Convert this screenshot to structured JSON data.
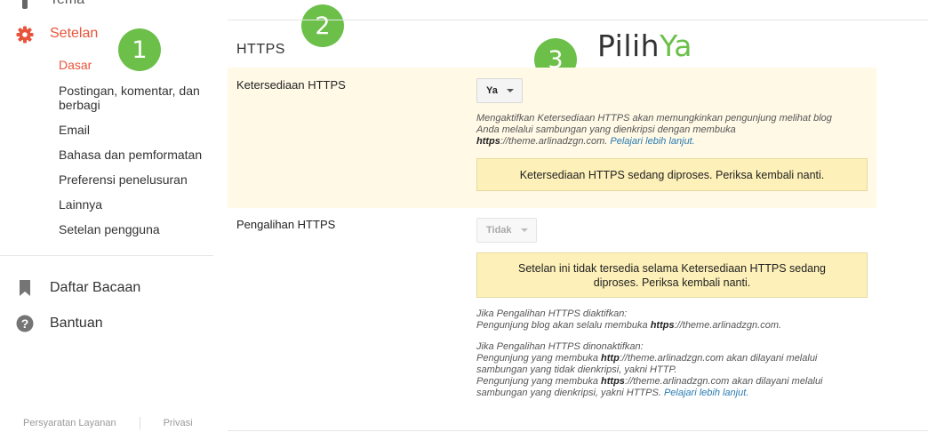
{
  "sidebar": {
    "tema_label": "Tema",
    "setelan_label": "Setelan",
    "sub_items": [
      "Dasar",
      "Postingan, komentar, dan",
      "berbagi",
      "Email",
      "Bahasa dan pemformatan",
      "Preferensi penelusuran",
      "Lainnya",
      "Setelan pengguna"
    ],
    "daftar_label": "Daftar Bacaan",
    "bantuan_label": "Bantuan",
    "footer": {
      "terms": "Persyaratan Layanan",
      "privacy": "Privasi"
    },
    "icons": {
      "tema": "palette-icon",
      "setelan": "gear-icon",
      "daftar": "bookmark-icon",
      "bantuan": "help-icon"
    }
  },
  "badges": {
    "one": "1",
    "two": "2",
    "three": "3"
  },
  "main": {
    "section_title": "HTTPS",
    "pilih": {
      "text": "Pilih",
      "ya": "Ya"
    },
    "availability": {
      "label": "Ketersediaan HTTPS",
      "select_value": "Ya",
      "desc_line1": "Mengaktifkan Ketersediaan HTTPS akan memungkinkan pengunjung melihat blog",
      "desc_line2": "Anda melalui sambungan yang dienkripsi dengan membuka",
      "desc_bold": "https",
      "desc_url": "://theme.arlinadzgn.com.",
      "desc_link": "Pelajari lebih lanjut.",
      "notice": "Ketersediaan HTTPS sedang diproses. Periksa kembali nanti."
    },
    "redirect": {
      "label": "Pengalihan HTTPS",
      "select_value": "Tidak",
      "notice_line1": "Setelan ini tidak tersedia selama Ketersediaan HTTPS sedang",
      "notice_line2": "diproses. Periksa kembali nanti.",
      "on_title": "Jika Pengalihan HTTPS diaktifkan:",
      "on_text_pre": "Pengunjung blog akan selalu membuka ",
      "on_bold": "https",
      "on_text_post": "://theme.arlinadzgn.com.",
      "off_title": "Jika Pengalihan HTTPS dinonaktifkan:",
      "off_l1_pre": "Pengunjung yang membuka ",
      "off_l1_bold": "http",
      "off_l1_post": "://theme.arlinadzgn.com akan dilayani melalui",
      "off_l2": "sambungan yang tidak dienkripsi, yakni HTTP.",
      "off_l3_pre": "Pengunjung yang membuka ",
      "off_l3_bold": "https",
      "off_l3_post": "://theme.arlinadzgn.com akan dilayani melalui",
      "off_l4": "sambungan yang dienkripsi, yakni HTTPS.",
      "off_link": "Pelajari lebih lanjut."
    }
  },
  "colors": {
    "accent": "#e8533b",
    "badge": "#6cc04a",
    "link": "#2a7ab0",
    "highlight": "#fff9e6",
    "notice": "#fdf0b8"
  }
}
